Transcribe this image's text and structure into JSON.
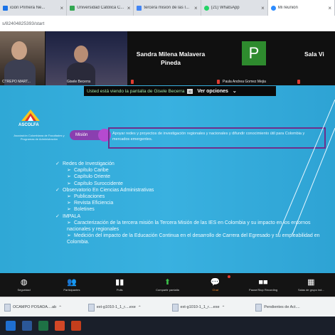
{
  "tabs": [
    {
      "label": "ición Primera Ne...",
      "color": "#1a73e8",
      "close": "×"
    },
    {
      "label": "Universidad Católica C...",
      "color": "#34a853",
      "close": "×"
    },
    {
      "label": "tercera misión de las I...",
      "color": "#4285f4",
      "close": "×"
    },
    {
      "label": "(21) WhatsApp",
      "color": "#25d366",
      "close": "×"
    },
    {
      "label": "Mi reunión",
      "color": "#2d8cff",
      "close": "×"
    }
  ],
  "address": {
    "url": "s/82404825393/start"
  },
  "participants": {
    "tile1_name": "CTREPO MART...",
    "tile2_name": "Gisele Becerra",
    "count": "35",
    "count_sub": "cuatro",
    "tile3_name": "Sandra Milena Malavera Pineda",
    "tile4_initial": "P",
    "tile4_name": "Paula Andrea Gomez Mejia",
    "tile5_name": "Sala Vi"
  },
  "notice": {
    "text": "Usted está viendo la pantalla de Gisele Becerra",
    "stop": "ID",
    "options": "Ver opciones"
  },
  "slide": {
    "logo": "ASCOLFA",
    "logo_sub": "Asociación Colombiana de Facultades y Programas de Administración",
    "pill": "Misión",
    "highlight": "Apoyar redes y proyectos de investigación regionales y nacionales y difundir conocimiento útil para Colombia y mercados emergentes.",
    "outline": [
      {
        "level": 1,
        "marker": "✓",
        "text": "Redes de Investigación"
      },
      {
        "level": 2,
        "marker": "➢",
        "text": "Capítulo Caribe"
      },
      {
        "level": 2,
        "marker": "➢",
        "text": "Capítulo Oriente"
      },
      {
        "level": 2,
        "marker": "➢",
        "text": "Capítulo Suroccidente"
      },
      {
        "level": 1,
        "marker": "✓",
        "text": "Observatorio En Ciencias Administrativas"
      },
      {
        "level": 2,
        "marker": "➢",
        "text": "Publicaciones"
      },
      {
        "level": 2,
        "marker": "➢",
        "text": "Revista Eficiencia"
      },
      {
        "level": 2,
        "marker": "➢",
        "text": "Boletines"
      },
      {
        "level": 1,
        "marker": "✓",
        "text": "IMPALA"
      },
      {
        "level": 2,
        "marker": "➢",
        "text": "Caracterización de la tercera misión la Tercera Misión de las IES en Colombia y su impacto en los entornos nacionales y regionales"
      },
      {
        "level": 2,
        "marker": "➢",
        "text": "Medición del impacto de la Educación Continua en el desarrollo de Carrera del Egresado y su empleabilidad en Colombia."
      }
    ]
  },
  "toolbar": [
    {
      "icon": "◍",
      "icon_name": "security-icon",
      "label": "Seguridad"
    },
    {
      "icon": "👥",
      "icon_name": "participants-icon",
      "label": "Participantes"
    },
    {
      "icon": "▮▮",
      "icon_name": "poll-icon",
      "label": "Polls"
    },
    {
      "icon": "⬆",
      "icon_name": "share-screen-icon",
      "label": "Compartir pantalla"
    },
    {
      "icon": "💬",
      "icon_name": "chat-icon",
      "label": "Chat"
    },
    {
      "icon": "■■",
      "icon_name": "record-icon",
      "label": "Pause/Stop Recording"
    },
    {
      "icon": "▦",
      "icon_name": "breakout-icon",
      "label": "Salas de grupo ind..."
    }
  ],
  "downloads": [
    {
      "name": "OCAMPO POSADA....ab"
    },
    {
      "name": "ext-g1010-1_1_r....exe"
    },
    {
      "name": "ext-g1010-1_1_r....exe"
    },
    {
      "name": "Pendientes de Act...."
    }
  ],
  "colors": {
    "slide_bg": "#39b1e0",
    "accent": "#8a3fb0",
    "chat": "#ff8a24",
    "avatar": "#2e8b2e"
  }
}
